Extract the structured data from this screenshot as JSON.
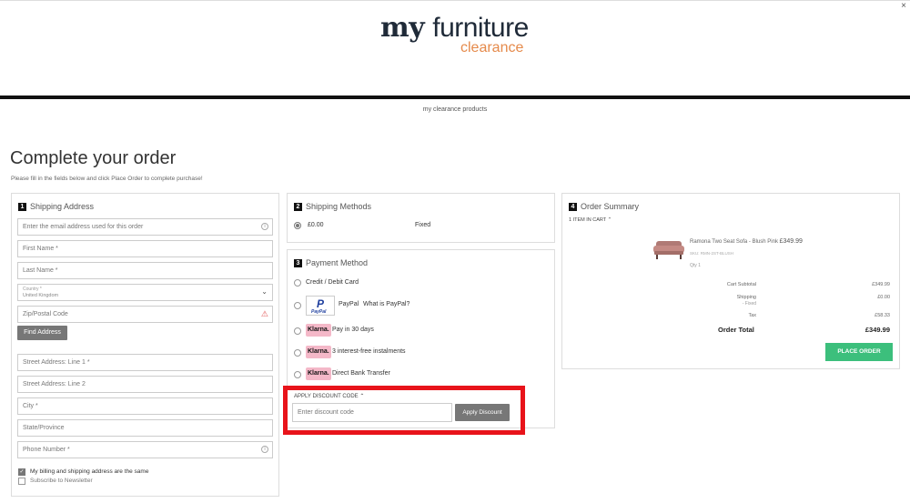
{
  "header": {
    "logo_line1_a": "my",
    "logo_line1_b": "furniture",
    "logo_line2": "clearance",
    "close": "×"
  },
  "nav": {
    "link": "my clearance products"
  },
  "page": {
    "title": "Complete your order",
    "subtitle": "Please fill in the fields below and click Place Order to complete purchase!"
  },
  "shipping_address": {
    "step": "1",
    "title": "Shipping Address",
    "email_placeholder": "Enter the email address used for this order",
    "first_name": "First Name *",
    "last_name": "Last Name *",
    "country_label": "Country *",
    "country_value": "United Kingdom",
    "zip": "Zip/Postal Code",
    "find_address": "Find Address",
    "street1": "Street Address: Line 1 *",
    "street2": "Street Address: Line 2",
    "city": "City *",
    "state": "State/Province",
    "phone": "Phone Number *",
    "same_address": "My billing and shipping address are the same",
    "newsletter": "Subscribe to Newsletter"
  },
  "shipping_methods": {
    "step": "2",
    "title": "Shipping Methods",
    "price": "£0.00",
    "method": "Fixed"
  },
  "payment": {
    "step": "3",
    "title": "Payment Method",
    "options": {
      "card": "Credit / Debit Card",
      "paypal": "PayPal",
      "paypal_what": "What is PayPal?",
      "klarna_30": "Pay in 30 days",
      "klarna_instal": "3 interest-free instalments",
      "klarna_bank": "Direct Bank Transfer"
    },
    "klarna_badge": "Klarna.",
    "paypal_logo_p": "P",
    "paypal_logo_text": "PayPal",
    "discount_toggle": "APPLY DISCOUNT CODE ⌃",
    "discount_placeholder": "Enter discount code",
    "apply_discount": "Apply Discount"
  },
  "order_summary": {
    "step": "4",
    "title": "Order Summary",
    "items_in_cart": "1 ITEM IN CART ⌃",
    "product_name": "Ramona Two Seat Sofa - Blush Pink",
    "product_price": "£349.99",
    "product_sku": "SKU: RMN-2ST-BLUSH",
    "product_qty": "Qty 1",
    "cart_subtotal_label": "Cart Subtotal",
    "cart_subtotal": "£349.99",
    "shipping_label": "Shipping",
    "shipping_sub": "- Fixed",
    "shipping": "£0.00",
    "tax_label": "Tax",
    "tax": "£58.33",
    "order_total_label": "Order Total",
    "order_total": "£349.99",
    "place_order": "PLACE ORDER"
  }
}
